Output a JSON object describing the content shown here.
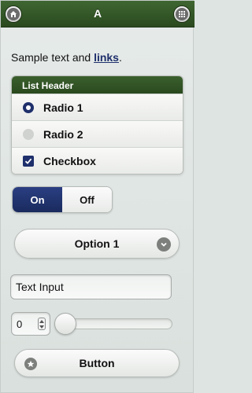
{
  "header": {
    "title": "A",
    "left_icon": "home-icon",
    "right_icon": "grid-icon"
  },
  "content": {
    "sample_text": "Sample text and ",
    "link_text": "links",
    "sample_suffix": "."
  },
  "list": {
    "header": "List Header",
    "items": [
      {
        "label": "Radio 1",
        "type": "radio",
        "checked": true
      },
      {
        "label": "Radio 2",
        "type": "radio",
        "checked": false
      },
      {
        "label": "Checkbox",
        "type": "checkbox",
        "checked": true
      }
    ]
  },
  "toggle": {
    "on_label": "On",
    "off_label": "Off",
    "selected": "On"
  },
  "select": {
    "selected_label": "Option 1",
    "icon": "chevron-down-icon"
  },
  "text_input": {
    "value": "Text Input",
    "placeholder": ""
  },
  "number_input": {
    "value": "0"
  },
  "slider": {
    "value": 0
  },
  "button": {
    "label": "Button",
    "icon": "star-icon"
  },
  "colors": {
    "header_bg": "#2f5224",
    "accent": "#1e2f6b"
  }
}
